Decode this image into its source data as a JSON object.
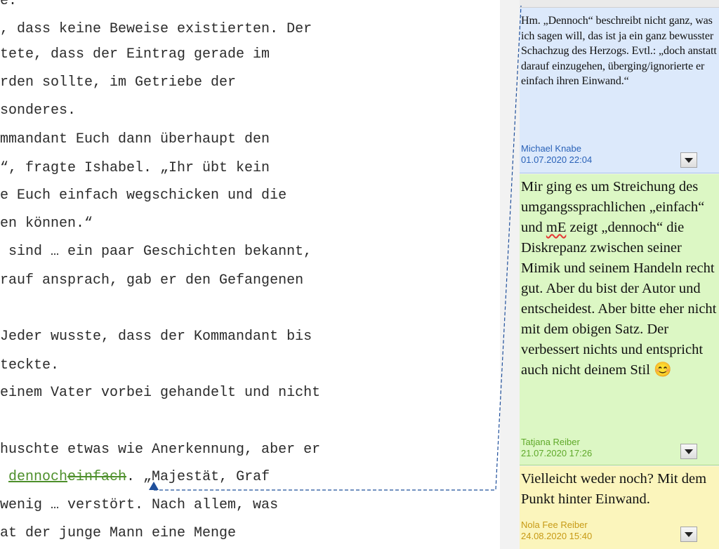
{
  "document": {
    "lines": [
      {
        "text": "e."
      },
      {
        "text": ", dass keine Beweise existierten. Der"
      },
      {
        "text": "tete, dass der Eintrag gerade im"
      },
      {
        "text": "rden sollte, im Getriebe der"
      },
      {
        "text": "sonderes."
      },
      {
        "text": "mmandant Euch dann überhaupt den"
      },
      {
        "text": "“, fragte Ishabel. „Ihr übt kein"
      },
      {
        "text": "e Euch einfach wegschicken und die"
      },
      {
        "text": "en können.“"
      },
      {
        "text": " sind … ein paar Geschichten bekannt,"
      },
      {
        "text": "rauf ansprach, gab er den Gefangenen"
      },
      {
        "text": ""
      },
      {
        "text": "Jeder wusste, dass der Kommandant bis"
      },
      {
        "text": "teckte."
      },
      {
        "text": "einem Vater vorbei gehandelt und nicht"
      },
      {
        "text": ""
      },
      {
        "text": "huschte etwas wie Anerkennung, aber er"
      },
      {
        "text": " ",
        "inserted": "dennoch",
        "deleted": "einfach",
        "after": ". „Majestät, Graf"
      },
      {
        "text": "wenig … verstört. Nach allem, was"
      },
      {
        "text": "at der junge Mann eine Menge"
      }
    ]
  },
  "comments": [
    {
      "text": "Hm. „Dennoch“ beschreibt nicht ganz, was ich sagen will, das ist ja ein ganz bewusster Schachzug des Herzogs. Evtl.: „doch anstatt darauf einzugehen, überging/ignorierte er einfach ihren Einwand.“",
      "author": "Michael Knabe",
      "date": "01.07.2020 22:04"
    },
    {
      "text_before": "Mir ging es um Streichung des umgangssprachlichen „einfach“ und ",
      "text_flagged": "mE",
      "text_after": " zeigt „dennoch“ die Diskrepanz zwischen seiner Mimik und seinem Handeln recht gut. Aber du bist der Autor und entscheidest. Aber bitte eher nicht mit dem obigen Satz. Der verbessert nichts und entspricht auch nicht deinem Stil 😊",
      "author": "Tatjana Reiber",
      "date": "21.07.2020 17:26"
    },
    {
      "text": "Vielleicht weder noch? Mit dem Punkt hinter Einwand.",
      "author": "Nola Fee Reiber",
      "date": "24.08.2020 15:40"
    }
  ],
  "colors": {
    "comment1_bg": "#dce9fb",
    "comment2_bg": "#dcf7c4",
    "comment3_bg": "#fbf5bc",
    "insertion": "#4d8f2a",
    "connector": "#1f4f9b"
  },
  "icons": {
    "comment_menu": "chevron-down-icon",
    "anchor": "comment-anchor-icon"
  }
}
